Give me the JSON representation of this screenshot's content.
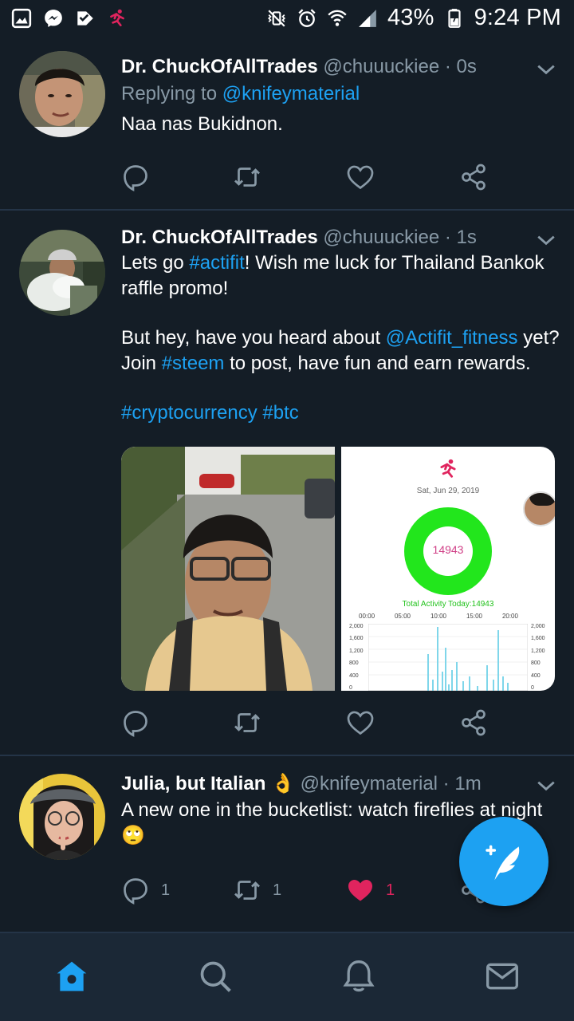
{
  "status_bar": {
    "battery": "43%",
    "time": "9:24 PM",
    "icons_left": [
      "gallery-icon",
      "messenger-icon",
      "check-app-icon",
      "actifit-icon"
    ],
    "icons_right": [
      "mute-vibrate-icon",
      "alarm-icon",
      "wifi-icon",
      "signal-icon",
      "battery-icon"
    ]
  },
  "tweets": [
    {
      "name": "Dr. ChuckOfAllTrades",
      "handle": "@chuuuckiee · 0s",
      "reply_prefix": "Replying to ",
      "reply_handle": "@knifeymaterial",
      "text": "Naa nas Bukidnon.",
      "reply_count": "",
      "retweet_count": "",
      "like_count": ""
    },
    {
      "name": "Dr. ChuckOfAllTrades",
      "handle": "@chuuuckiee · 1s",
      "line1_a": "Lets go ",
      "line1_tag": "#actifit",
      "line1_b": "! Wish me luck for Thailand Bankok raffle promo!",
      "line2_a": "But hey, have you heard about ",
      "line2_mention": "@Actifit_fitness",
      "line2_b": " yet? Join ",
      "line2_tag": "#steem",
      "line2_c": " to post, have fun and earn rewards.",
      "line3_tag1": "#cryptocurrency",
      "line3_tag2": "#btc",
      "media_card": {
        "date": "Sat, Jun 29, 2019",
        "steps": "14943",
        "activity": "Total Activity Today:14943",
        "time_ticks": [
          "00:00",
          "05:00",
          "10:00",
          "15:00",
          "20:00"
        ],
        "y_ticks": [
          "2,000",
          "1,600",
          "1,200",
          "800",
          "400",
          "0"
        ]
      }
    },
    {
      "name": "Julia, but Italian",
      "emoji": "👌",
      "handle": "@knifeymaterial · 1m",
      "text": "A new one in the bucketlist: watch fireflies at night",
      "emoji2": "🙄",
      "reply_count": "1",
      "retweet_count": "1",
      "like_count": "1"
    }
  ],
  "colors": {
    "background": "#141d26",
    "accent": "#1da1f2",
    "muted": "#8899a6",
    "like": "#e0245e"
  },
  "nav": [
    "home-icon",
    "search-icon",
    "notifications-icon",
    "messages-icon"
  ]
}
